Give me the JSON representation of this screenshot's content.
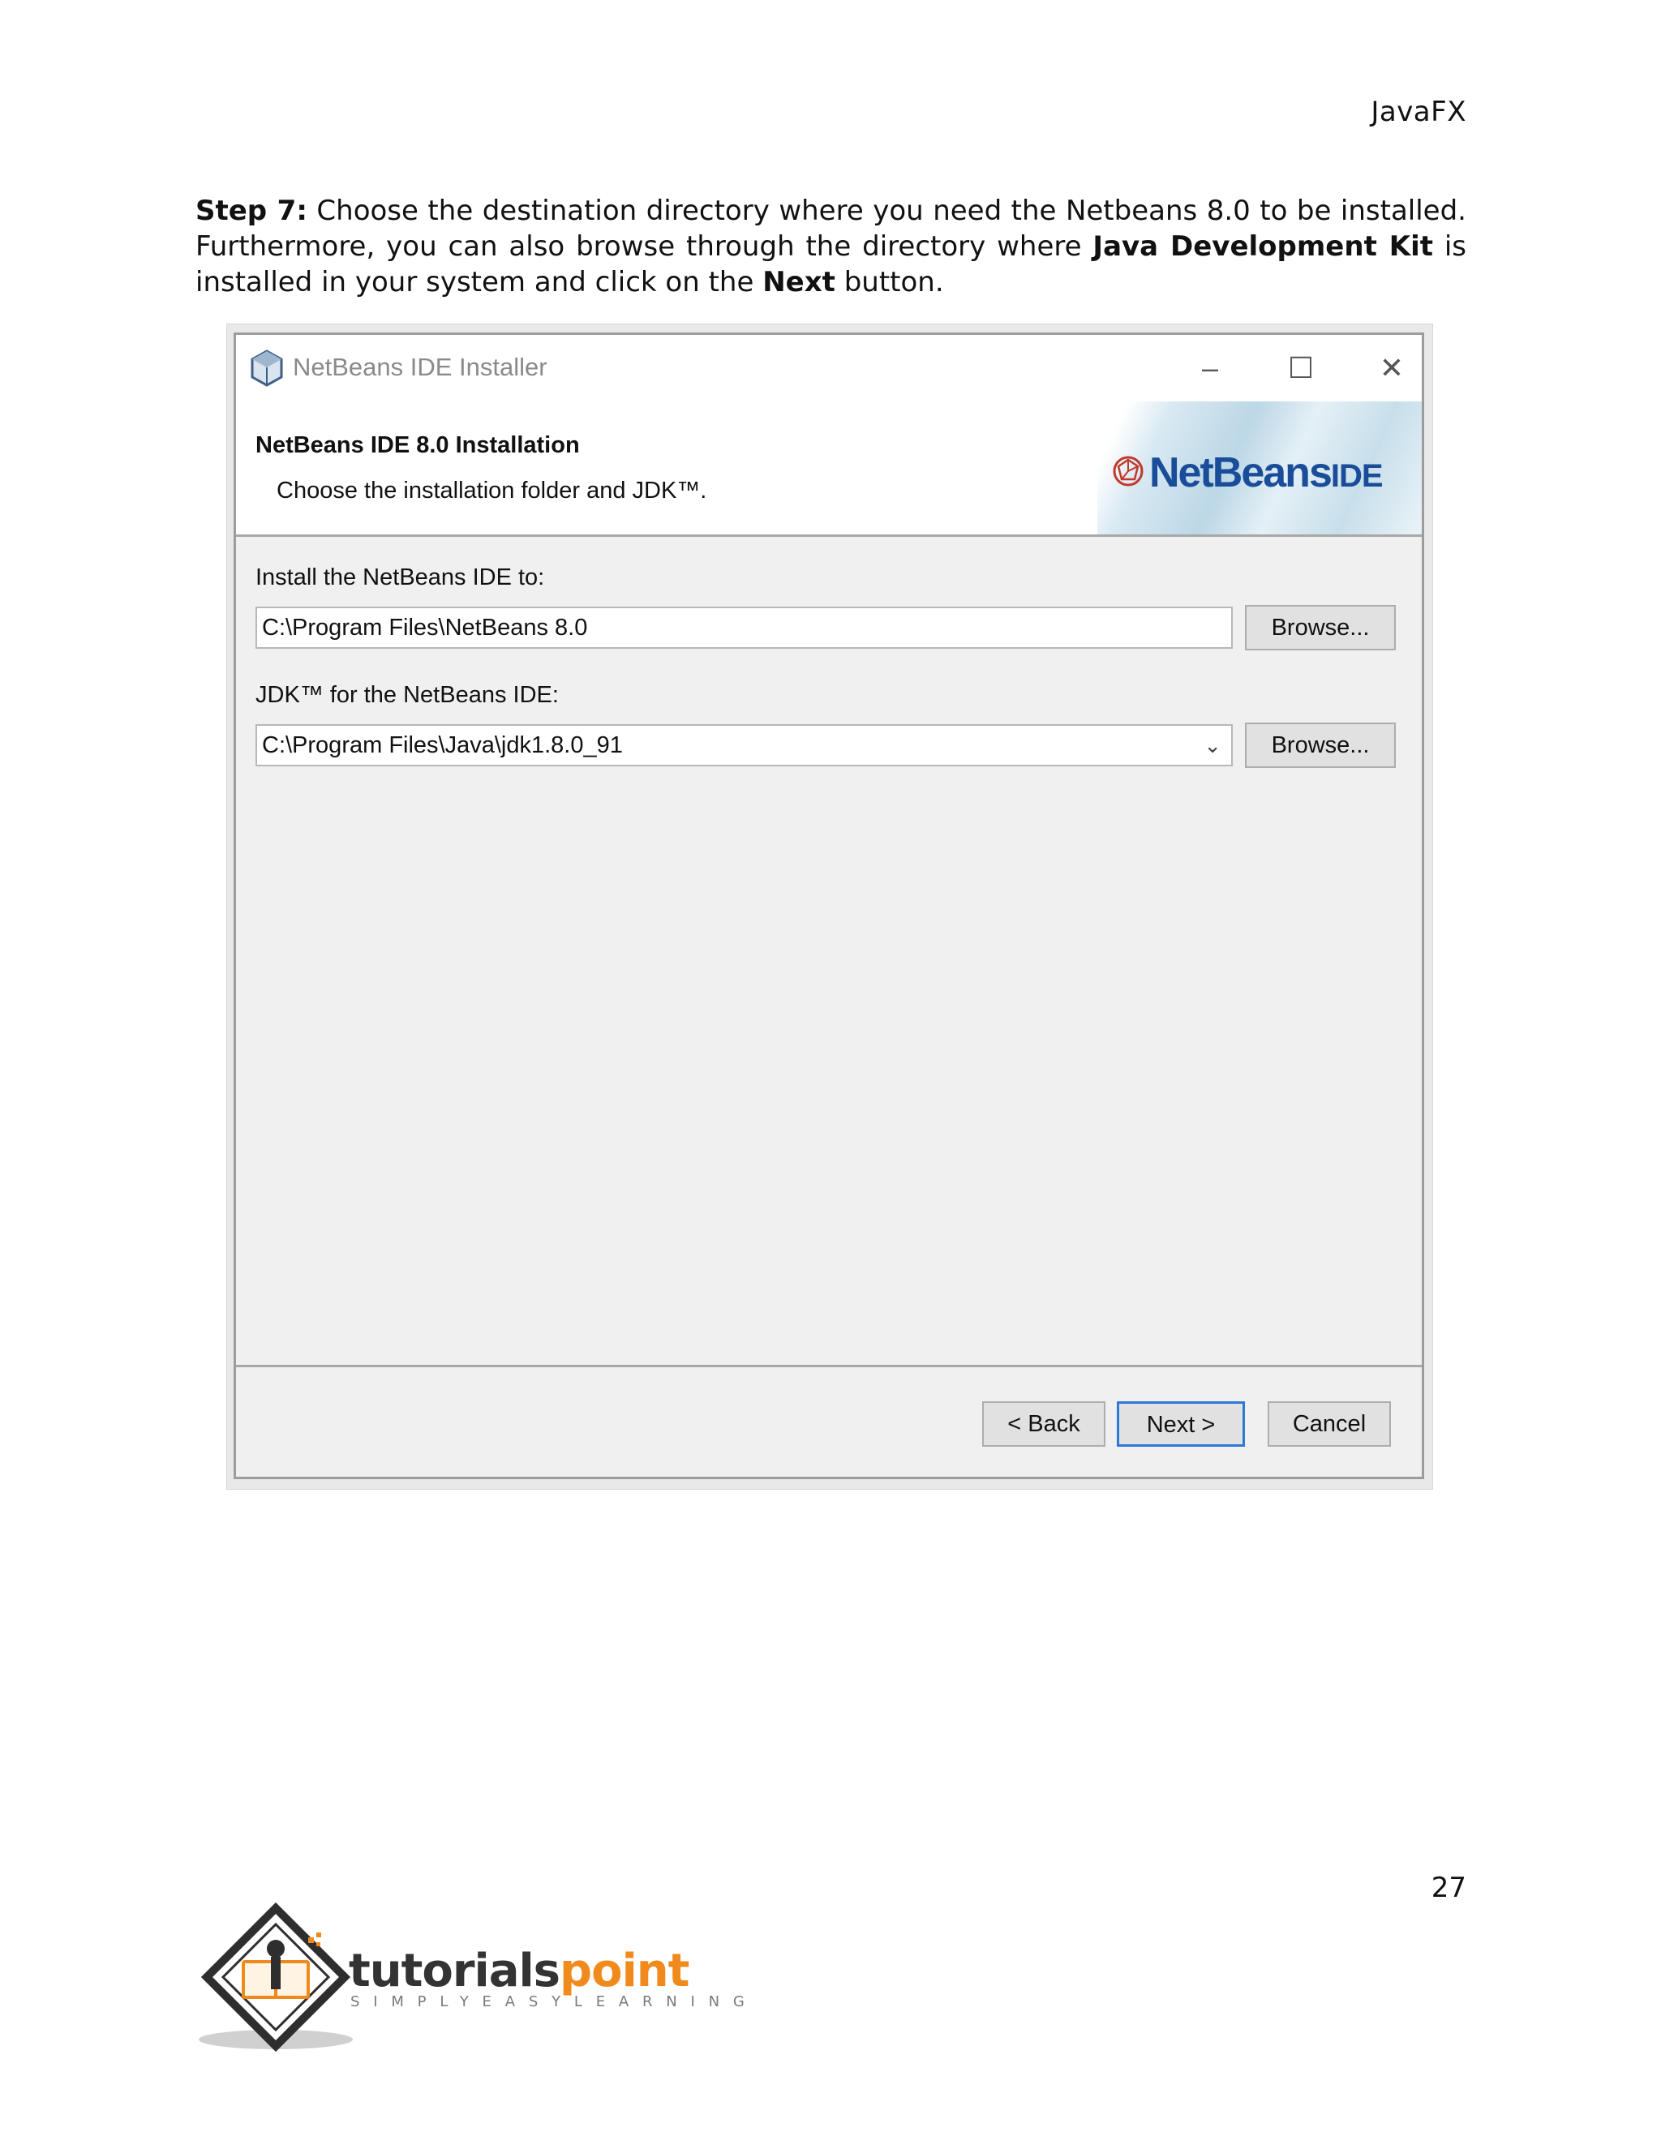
{
  "header": {
    "title": "JavaFX"
  },
  "paragraph": {
    "step_label": "Step 7:",
    "text_1": " Choose the destination directory where you need the Netbeans 8.0 to be installed. Furthermore, you can also browse through the directory where ",
    "bold_1": "Java Development Kit",
    "text_2": " is installed in your system and click on the ",
    "bold_2": "Next",
    "text_3": " button."
  },
  "installer": {
    "window_title": "NetBeans IDE Installer",
    "heading": "NetBeans IDE 8.0 Installation",
    "subheading": "Choose the installation folder and JDK™.",
    "logo_text": "NetBeans",
    "logo_suffix": "IDE",
    "install_label": "Install the NetBeans IDE to:",
    "install_path": "C:\\Program Files\\NetBeans 8.0",
    "jdk_label": "JDK™ for the NetBeans IDE:",
    "jdk_path": "C:\\Program Files\\Java\\jdk1.8.0_91",
    "browse_label": "Browse...",
    "back_label": "< Back",
    "next_label": "Next >",
    "cancel_label": "Cancel"
  },
  "footer": {
    "page_number": "27",
    "brand_part1": "tutorials",
    "brand_part2": "point",
    "tagline": "SIMPLYEASYLEARNING"
  },
  "colors": {
    "accent_blue": "#2b7bd6",
    "brand_orange": "#f08a1c",
    "brand_dark": "#333333"
  }
}
